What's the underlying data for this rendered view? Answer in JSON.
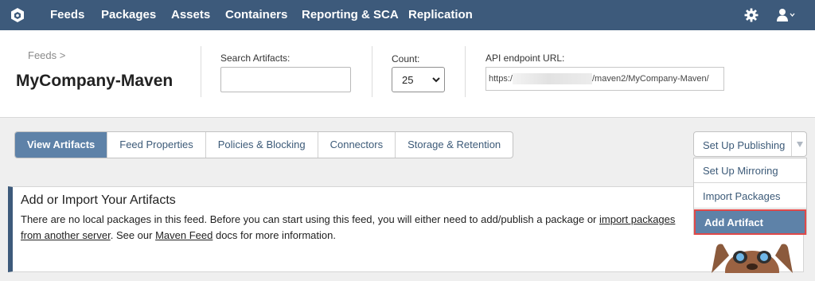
{
  "nav": {
    "items": [
      "Feeds",
      "Packages",
      "Assets",
      "Containers",
      "Reporting & SCA",
      "Replication"
    ],
    "logo_icon": "hexagon-logo-icon",
    "settings_icon": "gear-icon",
    "user_icon": "user-icon",
    "user_caret": "v"
  },
  "header": {
    "breadcrumb": "Feeds >",
    "feed_name": "MyCompany-Maven",
    "search_label": "Search Artifacts:",
    "search_value": "",
    "count_label": "Count:",
    "count_value": "25",
    "api_label": "API endpoint URL:",
    "api_prefix": "https://",
    "api_suffix": "/maven2/MyCompany-Maven/"
  },
  "tabs": [
    "View Artifacts",
    "Feed Properties",
    "Policies & Blocking",
    "Connectors",
    "Storage & Retention"
  ],
  "active_tab": "View Artifacts",
  "publishing": {
    "button_label": "Set Up Publishing",
    "menu": [
      "Set Up Mirroring",
      "Import Packages",
      "Add Artifact"
    ]
  },
  "info": {
    "title": "Add or Import Your Artifacts",
    "text_1": "There are no local packages in this feed. Before you can start using this feed, you will either need to add/publish a package or ",
    "link_1": "import packages from another server",
    "text_2": ". See our ",
    "link_2": "Maven Feed",
    "text_3": " docs for more information."
  },
  "colors": {
    "nav_bg": "#3d5a7b",
    "tab_active": "#5e82a8",
    "highlight_border": "#e04848"
  }
}
